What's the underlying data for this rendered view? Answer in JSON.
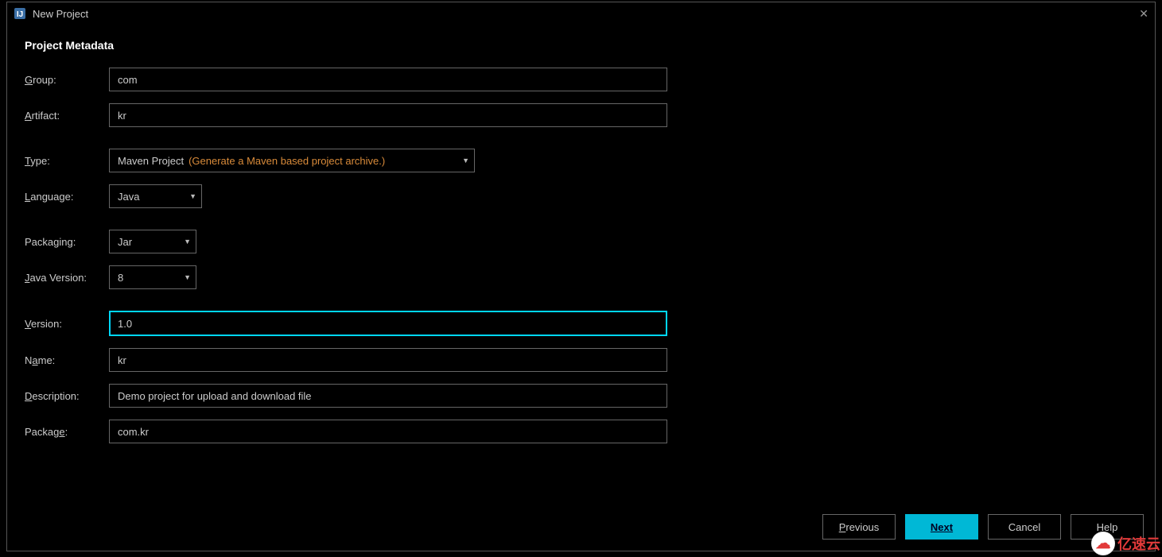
{
  "window": {
    "title": "New Project",
    "close_glyph": "✕"
  },
  "heading": "Project Metadata",
  "labels": {
    "group": "Group:",
    "artifact": "Artifact:",
    "type": "Type:",
    "language": "Language:",
    "packaging": "Packaging:",
    "java_version": "Java Version:",
    "version": "Version:",
    "name": "Name:",
    "description": "Description:",
    "package": "Package:"
  },
  "values": {
    "group": "com",
    "artifact": "kr",
    "type": "Maven Project",
    "type_hint": "(Generate a Maven based project archive.)",
    "language": "Java",
    "packaging": "Jar",
    "java_version": "8",
    "version": "1.0",
    "name": "kr",
    "description": "Demo project for upload and download file",
    "package": "com.kr"
  },
  "buttons": {
    "previous": "Previous",
    "next": "Next",
    "cancel": "Cancel",
    "help": "Help"
  },
  "watermark": "亿速云"
}
